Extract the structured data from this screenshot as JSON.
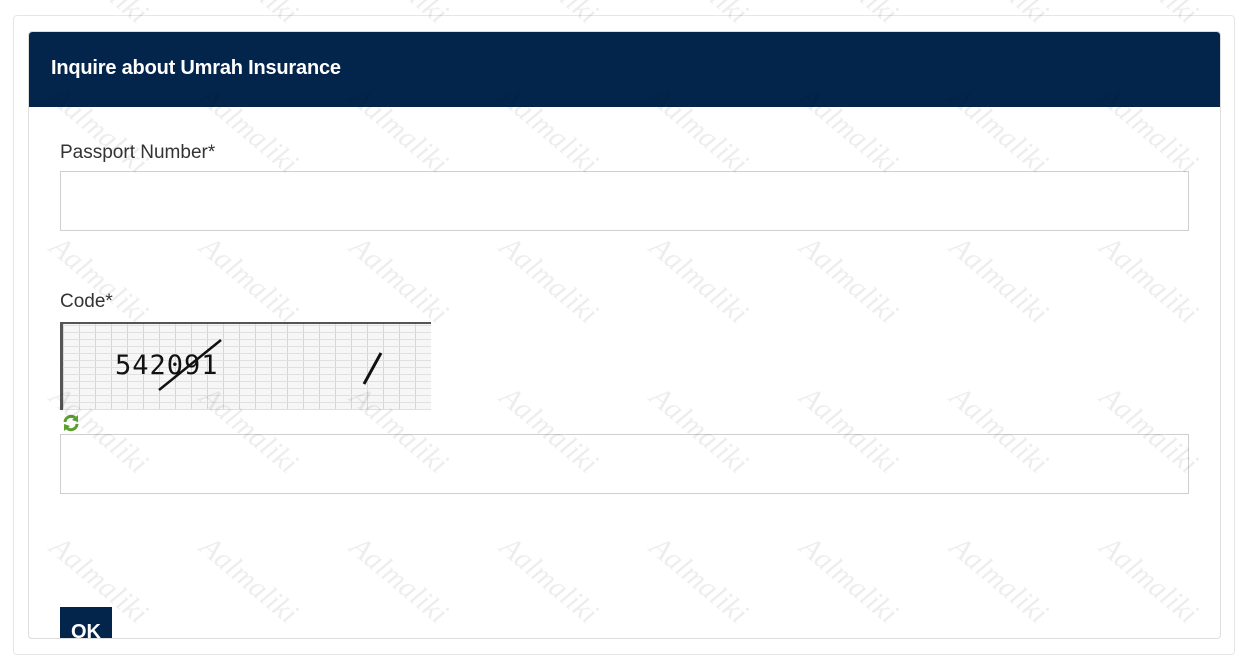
{
  "form": {
    "title": "Inquire about Umrah Insurance",
    "passport": {
      "label": "Passport Number*",
      "value": "",
      "placeholder": ""
    },
    "code": {
      "label": "Code*",
      "captcha_text": "542091",
      "value": "",
      "placeholder": ""
    },
    "ok_label": "OK"
  },
  "watermark": "Aalmaliki",
  "colors": {
    "header_bg": "#03254c",
    "button_bg": "#03254c",
    "refresh_icon": "#5a9e2f"
  },
  "icons": {
    "refresh": "refresh-icon"
  }
}
